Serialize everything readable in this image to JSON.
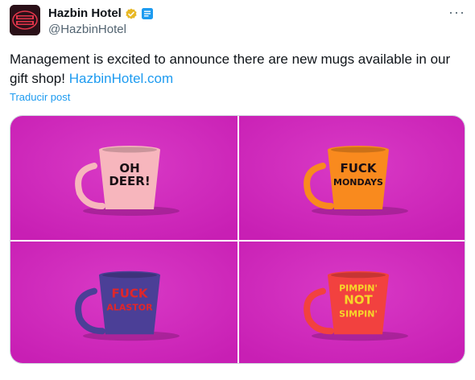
{
  "account": {
    "display_name": "Hazbin Hotel",
    "handle": "@HazbinHotel",
    "avatar_text": "HAZBIN HOTEL"
  },
  "post": {
    "text": "Management is excited to announce there are new mugs available in our gift shop! ",
    "link_text": "HazbinHotel.com",
    "translate_label": "Traducir post",
    "more_label": "···"
  },
  "media": [
    {
      "mug_color": "#f7b6bd",
      "text_lines": [
        "OH",
        "DEER!"
      ],
      "text_color": "#1a0f14"
    },
    {
      "mug_color": "#f98a1e",
      "text_lines": [
        "FUCK",
        "MONDAYS"
      ],
      "text_color": "#1a0f14"
    },
    {
      "mug_color": "#4b3f97",
      "text_lines": [
        "FUCK",
        "ALASTOR"
      ],
      "text_color": "#e0262a"
    },
    {
      "mug_color": "#f2413f",
      "text_lines": [
        "PIMPIN'",
        "NOT",
        "SIMPIN'"
      ],
      "text_color": "#f7d62a"
    }
  ],
  "colors": {
    "background_magenta": "#c81fb4",
    "accent_blue": "#1d9bf0",
    "verified_gold": "#e8b824"
  }
}
